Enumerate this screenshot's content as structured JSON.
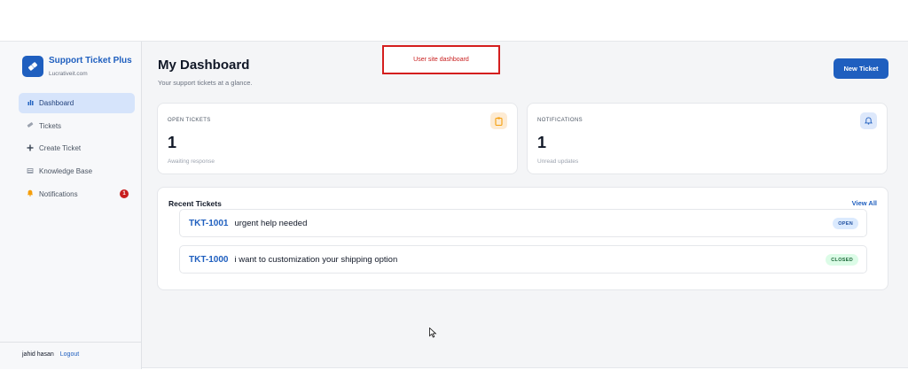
{
  "brand": {
    "title": "Support Ticket Plus",
    "subtitle": "Lucrativeit.com"
  },
  "sidebar": {
    "items": [
      {
        "label": "Dashboard",
        "icon": "bar-chart-icon",
        "active": true
      },
      {
        "label": "Tickets",
        "icon": "ticket-icon"
      },
      {
        "label": "Create Ticket",
        "icon": "plus-icon"
      },
      {
        "label": "Knowledge Base",
        "icon": "book-icon"
      },
      {
        "label": "Notifications",
        "icon": "bell-icon",
        "badge": "1"
      }
    ],
    "footer": {
      "user": "jahid hasan",
      "logout": "Logout"
    }
  },
  "header": {
    "title": "My Dashboard",
    "subtitle": "Your support tickets at a glance.",
    "new_ticket": "New Ticket"
  },
  "annotation": {
    "text": "User site dashboard",
    "color": "#d41e1e"
  },
  "stats": {
    "open": {
      "label": "OPEN TICKETS",
      "value": "1",
      "note": "Awaiting response",
      "icon": "clipboard-icon",
      "color": "#f59e0b"
    },
    "notifications": {
      "label": "NOTIFICATIONS",
      "value": "1",
      "note": "Unread updates",
      "icon": "bell-icon",
      "color": "#1f5fbf"
    }
  },
  "recent": {
    "title": "Recent Tickets",
    "view_all": "View All",
    "tickets": [
      {
        "id": "TKT-1001",
        "subject": "urgent help needed",
        "status": "OPEN"
      },
      {
        "id": "TKT-1000",
        "subject": "i want to customization your shipping option",
        "status": "CLOSED"
      }
    ]
  },
  "colors": {
    "accent": "#1f5fbf",
    "badge": "#c81e1e",
    "open": "#dbeafe",
    "closed": "#dcfce7"
  }
}
